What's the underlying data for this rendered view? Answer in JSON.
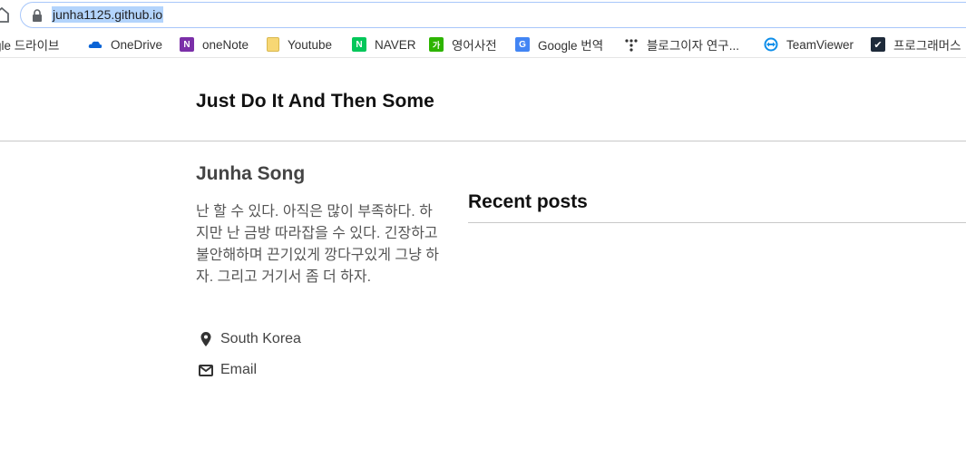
{
  "browser": {
    "url": "junha1125.github.io"
  },
  "bookmarks": [
    {
      "label": "gle 드라이브",
      "icon": "google-drive-icon"
    },
    {
      "label": "OneDrive",
      "icon": "onedrive-icon",
      "color": "#0a64d6"
    },
    {
      "label": "oneNote",
      "icon": "onenote-icon",
      "color": "#7b2fa8"
    },
    {
      "label": "Youtube",
      "icon": "folder-icon",
      "color": "#f7d774"
    },
    {
      "label": "NAVER",
      "icon": "naver-icon",
      "color": "#03c75a"
    },
    {
      "label": "영어사전",
      "icon": "naver-dictionary-icon",
      "color": "#2db400"
    },
    {
      "label": "Google 번역",
      "icon": "google-translate-icon",
      "color": "#4285f4"
    },
    {
      "label": "블로그이자 연구...",
      "icon": "dots-icon"
    },
    {
      "label": "TeamViewer",
      "icon": "teamviewer-icon",
      "color": "#0e8ee9"
    },
    {
      "label": "프로그래머스",
      "icon": "programmers-icon",
      "color": "#1e2a3a"
    }
  ],
  "site": {
    "title": "Just Do It And Then Some"
  },
  "author": {
    "name": "Junha Song",
    "bio": "난 할 수 있다. 아직은 많이 부족하다. 하지만 난 금방 따라잡을 수 있다. 긴장하고 불안해하며 끈기있게 깡다구있게 그냥 하자. 그리고 거기서 좀 더 하자.",
    "location": "South Korea",
    "email_label": "Email"
  },
  "recent": {
    "title": "Recent posts"
  }
}
